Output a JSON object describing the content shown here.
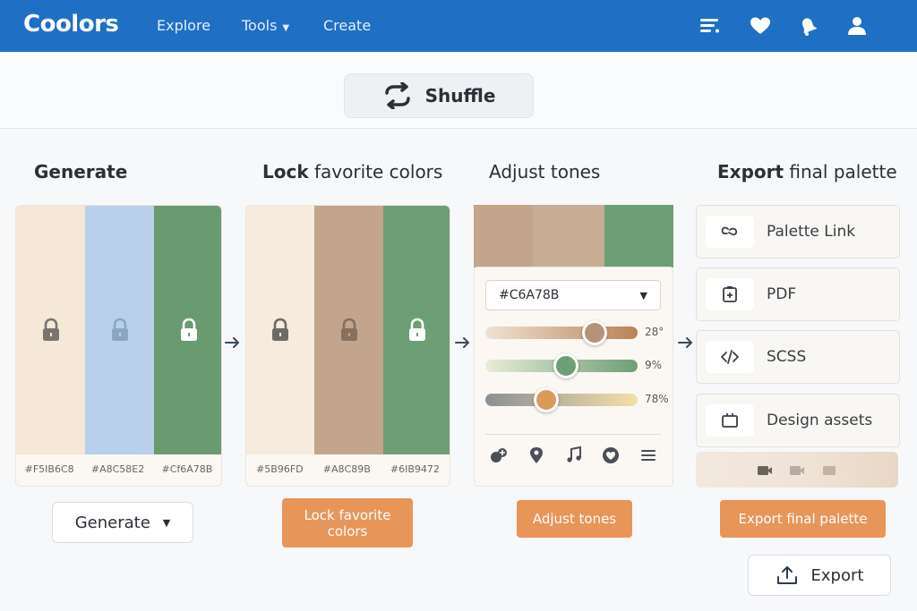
{
  "nav": {
    "logo": "Coolors",
    "links": [
      "Explore",
      "Tools",
      "Create"
    ]
  },
  "shuffle_label": "Shuffle",
  "steps": {
    "generate": {
      "heading": "Generate",
      "swatches": [
        "#F5E8D6",
        "#B8D0EA",
        "#6A9A70"
      ],
      "codes": [
        "#F5IB6C8",
        "#A8C58E2",
        "#Cf6A78B"
      ],
      "button": "Generate"
    },
    "lock": {
      "heading_bold": "Lock",
      "heading_rest": " favorite colors",
      "swatches": [
        "#F6EBDD",
        "#C3A48C",
        "#6E9E76"
      ],
      "codes": [
        "#5B96FD",
        "#A8C89B",
        "#6IB9472"
      ],
      "button": "Lock favorite colors"
    },
    "adjust": {
      "heading": "Adjust tones",
      "top_swatches": [
        "#C3A58C",
        "#C8AD95",
        "#6E9E76"
      ],
      "hex_value": "#C6A78B",
      "sliders": [
        {
          "value": "28°",
          "fraction": 0.72,
          "from": "#efe2d4",
          "to": "#b98355",
          "knob": "#b5937a"
        },
        {
          "value": "9%",
          "fraction": 0.53,
          "from": "#e8ecd8",
          "to": "#6e9e76",
          "knob": "#6e9e76"
        },
        {
          "value": "78%",
          "fraction": 0.4,
          "from": "#8b8f94",
          "to": "#f5dfa8",
          "knob": "#d99a5c"
        }
      ],
      "button": "Adjust tones"
    },
    "export": {
      "heading_bold": "Export",
      "heading_rest": " final palette",
      "items": [
        "Palette Link",
        "PDF",
        "SCSS",
        "Design assets"
      ],
      "button": "Export final palette",
      "export_button": "Export"
    }
  },
  "colors": {
    "nav_bg": "#1f6fc4",
    "accent_orange": "#e8955a"
  }
}
